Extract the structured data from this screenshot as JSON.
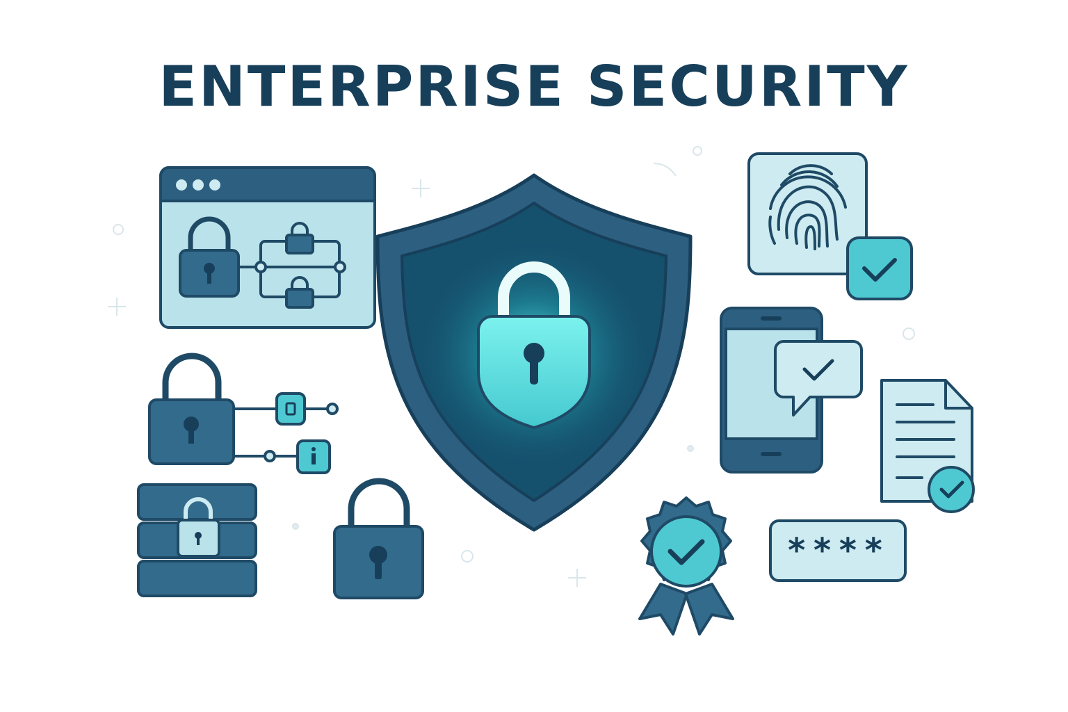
{
  "title": "ENTERPRISE SECURITY",
  "password_field": {
    "masked_value": "****"
  },
  "icons": [
    "browser-window-lock-network-icon",
    "shield-lock-icon",
    "fingerprint-icon",
    "verified-check-badge-icon",
    "smartphone-icon",
    "chat-check-icon",
    "padlock-connected-nodes-icon",
    "document-check-icon",
    "database-lock-icon",
    "padlock-icon",
    "award-ribbon-check-icon",
    "password-field-icon"
  ],
  "colors": {
    "navy": "#173f5a",
    "dark_blue": "#2d5f80",
    "mid_blue": "#336b8c",
    "light_blue": "#b9e2ea",
    "pale": "#cdebf0",
    "teal": "#4fc9d1",
    "glow": "#6ef0ec"
  }
}
